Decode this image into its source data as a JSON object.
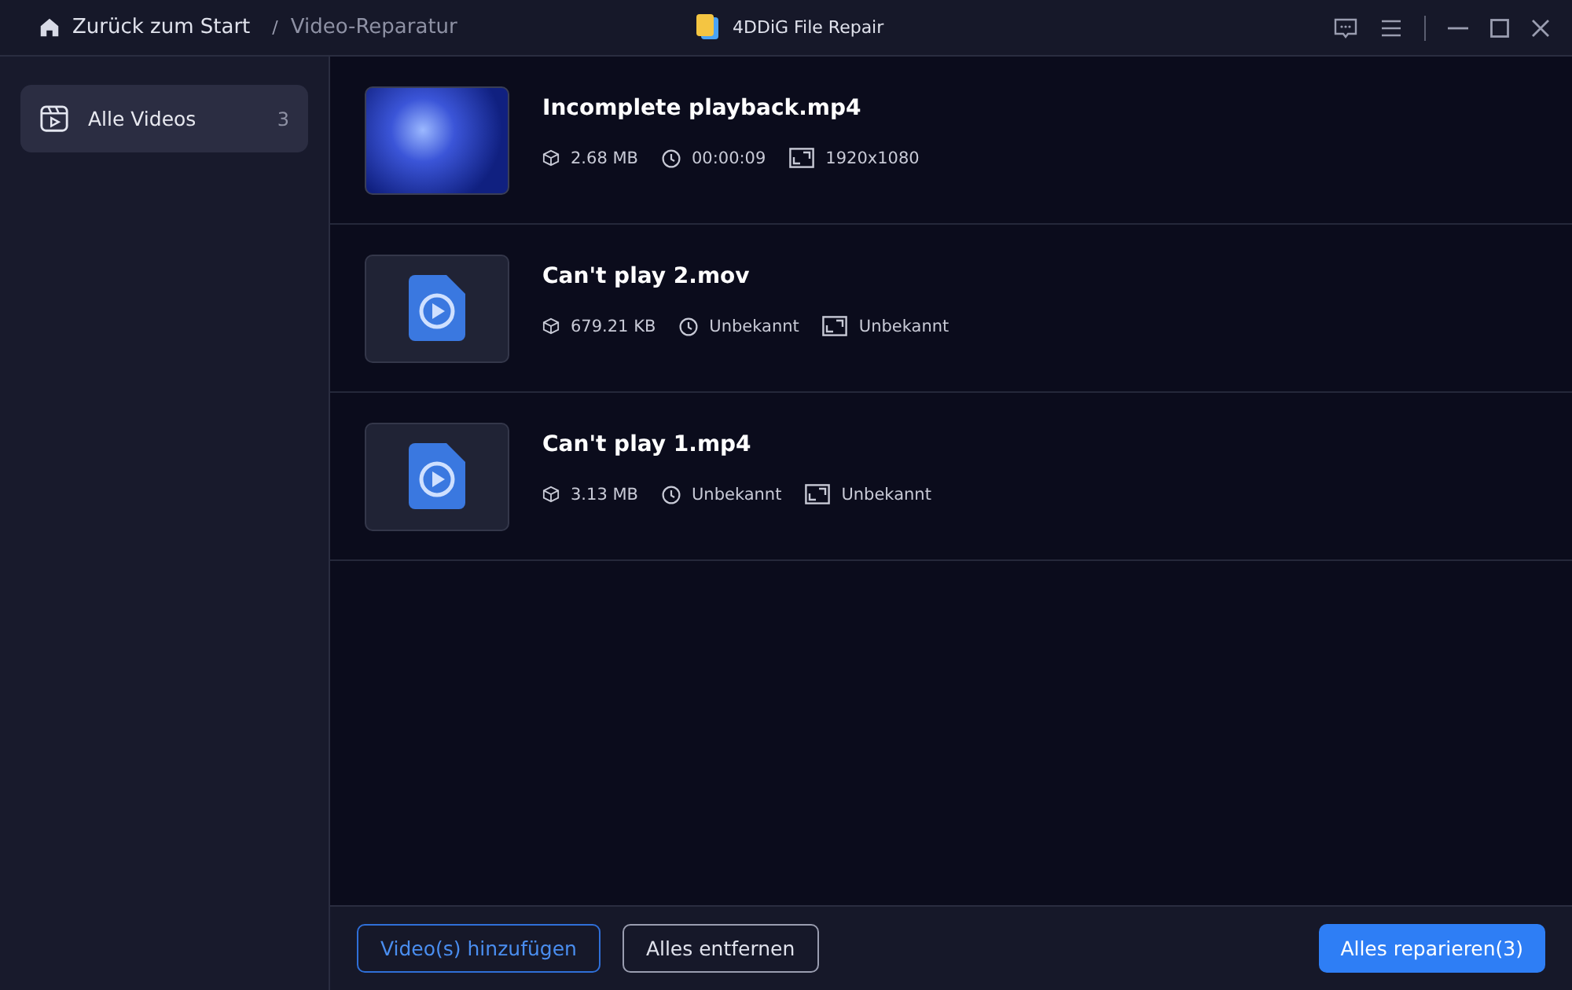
{
  "titlebar": {
    "back": "Zurück zum Start",
    "separator": "/",
    "page": "Video-Reparatur",
    "app_title": "4DDiG File Repair"
  },
  "sidebar": {
    "items": [
      {
        "label": "Alle Videos",
        "count": "3",
        "selected": true
      }
    ]
  },
  "videos": [
    {
      "name": "Incomplete playback.mp4",
      "kind": "photo",
      "size": "2.68 MB",
      "duration": "00:00:09",
      "resolution": "1920x1080"
    },
    {
      "name": "Can't play 2.mov",
      "kind": "file",
      "size": "679.21 KB",
      "duration": "Unbekannt",
      "resolution": "Unbekannt"
    },
    {
      "name": "Can't play 1.mp4",
      "kind": "file",
      "size": "3.13 MB",
      "duration": "Unbekannt",
      "resolution": "Unbekannt"
    }
  ],
  "footer": {
    "add": "Video(s) hinzufügen",
    "remove": "Alles entfernen",
    "repair": "Alles reparieren(3)"
  }
}
